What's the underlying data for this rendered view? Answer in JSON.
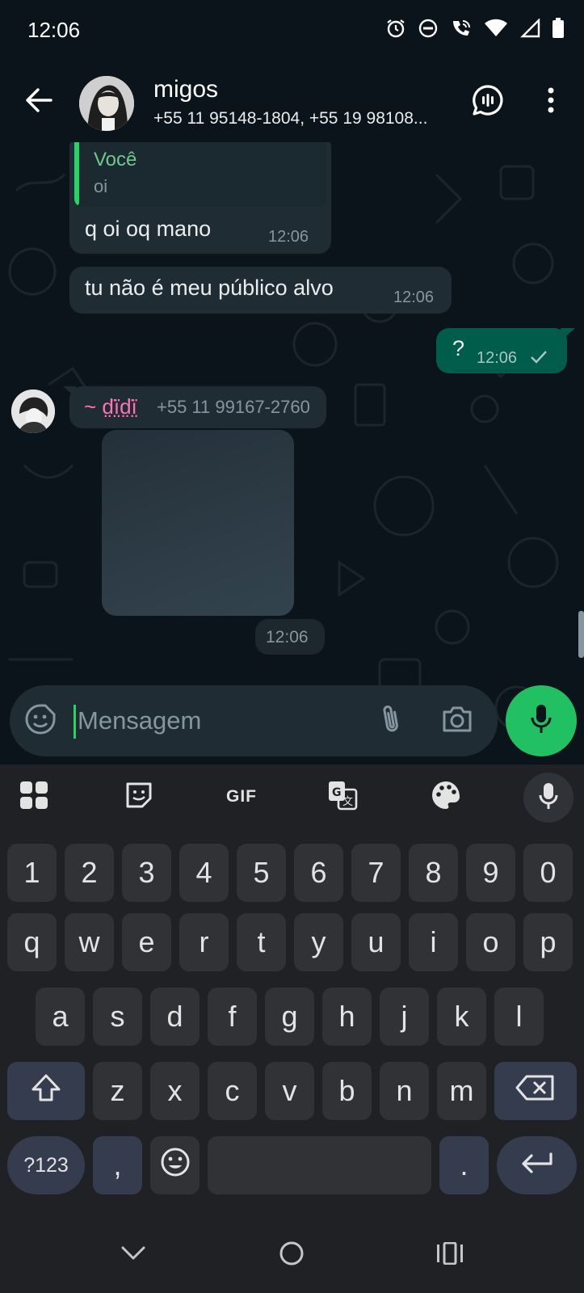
{
  "status_bar": {
    "time": "12:06"
  },
  "header": {
    "group_name": "migos",
    "members": "+55 11 95148-1804, +55 19 98108..."
  },
  "messages": {
    "reply": {
      "quote_author": "Você",
      "quote_text": "oi",
      "text": "q oi oq mano",
      "time": "12:06"
    },
    "incoming_2": {
      "text": "tu não é meu público alvo",
      "time": "12:06"
    },
    "outgoing_1": {
      "text": "?",
      "time": "12:06"
    },
    "sticker_message": {
      "sender_name": "~ d̤̈ï̤d̤̈ï̤",
      "sender_phone": "+55 11 99167-2760",
      "time": "12:06"
    }
  },
  "composer": {
    "placeholder": "Mensagem"
  },
  "keyboard": {
    "toolbar": {
      "gif_label": "GIF"
    },
    "row_numbers": [
      "1",
      "2",
      "3",
      "4",
      "5",
      "6",
      "7",
      "8",
      "9",
      "0"
    ],
    "row_q": [
      "q",
      "w",
      "e",
      "r",
      "t",
      "y",
      "u",
      "i",
      "o",
      "p"
    ],
    "row_a": [
      "a",
      "s",
      "d",
      "f",
      "g",
      "h",
      "j",
      "k",
      "l"
    ],
    "row_z": [
      "z",
      "x",
      "c",
      "v",
      "b",
      "n",
      "m"
    ],
    "symbols_label": "?123",
    "comma": ",",
    "period": "."
  },
  "icons": {
    "status": [
      "alarm-icon",
      "do-not-disturb-icon",
      "wifi-calling-icon",
      "wifi-icon",
      "signal-icon",
      "battery-icon"
    ],
    "header": [
      "back-arrow-icon",
      "group-call-icon",
      "more-vert-icon"
    ],
    "composer": [
      "sticker-emoji-icon",
      "attach-icon",
      "camera-icon",
      "mic-icon"
    ]
  },
  "colors": {
    "background": "#0b141a",
    "incoming_bubble": "#202c33",
    "outgoing_bubble": "#005c4b",
    "accent_green": "#21c063",
    "sender_name": "#ff72b8"
  }
}
